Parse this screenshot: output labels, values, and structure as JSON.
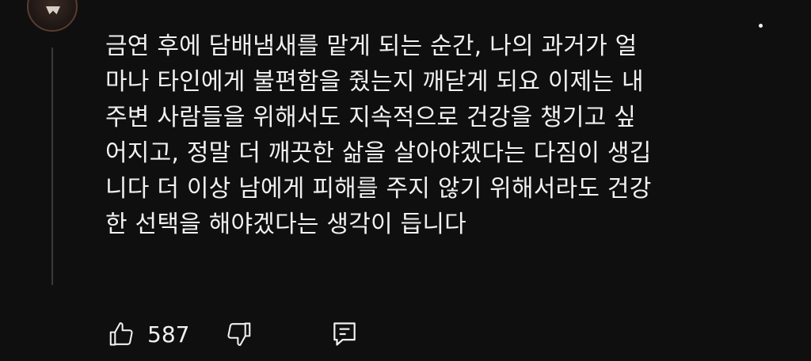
{
  "comment": {
    "avatar_label": "",
    "text_lines": [
      "금연 후에 담배냄새를 맡게 되는 순간, 나의 과거가 얼",
      "마나 타인에게 불편함을 줬는지 깨닫게 되요 이제는 내",
      "주변 사람들을 위해서도 지속적으로 건강을 챙기고 싶",
      "어지고, 정말 더 깨끗한 삶을 살아야겠다는 다짐이 생깁",
      "니다 더 이상 남에게 피해를 주지 않기 위해서라도 건강",
      "한 선택을 해야겠다는 생각이 듭니다"
    ],
    "like_count": "587"
  },
  "icons": {
    "like": "thumbs-up-icon",
    "dislike": "thumbs-down-icon",
    "reply": "reply-comment-icon",
    "menu": "more-options-icon"
  },
  "colors": {
    "background": "#0f0f0f",
    "text": "#f1f1f1",
    "thread_line": "#3a3a3a"
  }
}
